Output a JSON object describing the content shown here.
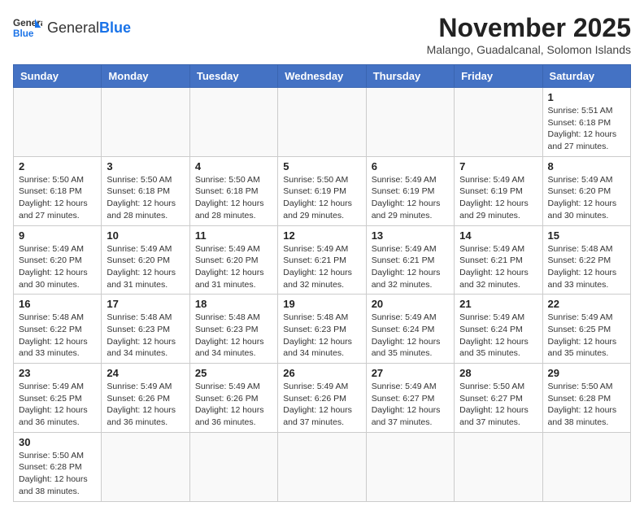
{
  "logo": {
    "general": "General",
    "blue": "Blue"
  },
  "title": "November 2025",
  "subtitle": "Malango, Guadalcanal, Solomon Islands",
  "headers": [
    "Sunday",
    "Monday",
    "Tuesday",
    "Wednesday",
    "Thursday",
    "Friday",
    "Saturday"
  ],
  "weeks": [
    [
      {
        "day": "",
        "info": ""
      },
      {
        "day": "",
        "info": ""
      },
      {
        "day": "",
        "info": ""
      },
      {
        "day": "",
        "info": ""
      },
      {
        "day": "",
        "info": ""
      },
      {
        "day": "",
        "info": ""
      },
      {
        "day": "1",
        "info": "Sunrise: 5:51 AM\nSunset: 6:18 PM\nDaylight: 12 hours and 27 minutes."
      }
    ],
    [
      {
        "day": "2",
        "info": "Sunrise: 5:50 AM\nSunset: 6:18 PM\nDaylight: 12 hours and 27 minutes."
      },
      {
        "day": "3",
        "info": "Sunrise: 5:50 AM\nSunset: 6:18 PM\nDaylight: 12 hours and 28 minutes."
      },
      {
        "day": "4",
        "info": "Sunrise: 5:50 AM\nSunset: 6:18 PM\nDaylight: 12 hours and 28 minutes."
      },
      {
        "day": "5",
        "info": "Sunrise: 5:50 AM\nSunset: 6:19 PM\nDaylight: 12 hours and 29 minutes."
      },
      {
        "day": "6",
        "info": "Sunrise: 5:49 AM\nSunset: 6:19 PM\nDaylight: 12 hours and 29 minutes."
      },
      {
        "day": "7",
        "info": "Sunrise: 5:49 AM\nSunset: 6:19 PM\nDaylight: 12 hours and 29 minutes."
      },
      {
        "day": "8",
        "info": "Sunrise: 5:49 AM\nSunset: 6:20 PM\nDaylight: 12 hours and 30 minutes."
      }
    ],
    [
      {
        "day": "9",
        "info": "Sunrise: 5:49 AM\nSunset: 6:20 PM\nDaylight: 12 hours and 30 minutes."
      },
      {
        "day": "10",
        "info": "Sunrise: 5:49 AM\nSunset: 6:20 PM\nDaylight: 12 hours and 31 minutes."
      },
      {
        "day": "11",
        "info": "Sunrise: 5:49 AM\nSunset: 6:20 PM\nDaylight: 12 hours and 31 minutes."
      },
      {
        "day": "12",
        "info": "Sunrise: 5:49 AM\nSunset: 6:21 PM\nDaylight: 12 hours and 32 minutes."
      },
      {
        "day": "13",
        "info": "Sunrise: 5:49 AM\nSunset: 6:21 PM\nDaylight: 12 hours and 32 minutes."
      },
      {
        "day": "14",
        "info": "Sunrise: 5:49 AM\nSunset: 6:21 PM\nDaylight: 12 hours and 32 minutes."
      },
      {
        "day": "15",
        "info": "Sunrise: 5:48 AM\nSunset: 6:22 PM\nDaylight: 12 hours and 33 minutes."
      }
    ],
    [
      {
        "day": "16",
        "info": "Sunrise: 5:48 AM\nSunset: 6:22 PM\nDaylight: 12 hours and 33 minutes."
      },
      {
        "day": "17",
        "info": "Sunrise: 5:48 AM\nSunset: 6:23 PM\nDaylight: 12 hours and 34 minutes."
      },
      {
        "day": "18",
        "info": "Sunrise: 5:48 AM\nSunset: 6:23 PM\nDaylight: 12 hours and 34 minutes."
      },
      {
        "day": "19",
        "info": "Sunrise: 5:48 AM\nSunset: 6:23 PM\nDaylight: 12 hours and 34 minutes."
      },
      {
        "day": "20",
        "info": "Sunrise: 5:49 AM\nSunset: 6:24 PM\nDaylight: 12 hours and 35 minutes."
      },
      {
        "day": "21",
        "info": "Sunrise: 5:49 AM\nSunset: 6:24 PM\nDaylight: 12 hours and 35 minutes."
      },
      {
        "day": "22",
        "info": "Sunrise: 5:49 AM\nSunset: 6:25 PM\nDaylight: 12 hours and 35 minutes."
      }
    ],
    [
      {
        "day": "23",
        "info": "Sunrise: 5:49 AM\nSunset: 6:25 PM\nDaylight: 12 hours and 36 minutes."
      },
      {
        "day": "24",
        "info": "Sunrise: 5:49 AM\nSunset: 6:26 PM\nDaylight: 12 hours and 36 minutes."
      },
      {
        "day": "25",
        "info": "Sunrise: 5:49 AM\nSunset: 6:26 PM\nDaylight: 12 hours and 36 minutes."
      },
      {
        "day": "26",
        "info": "Sunrise: 5:49 AM\nSunset: 6:26 PM\nDaylight: 12 hours and 37 minutes."
      },
      {
        "day": "27",
        "info": "Sunrise: 5:49 AM\nSunset: 6:27 PM\nDaylight: 12 hours and 37 minutes."
      },
      {
        "day": "28",
        "info": "Sunrise: 5:50 AM\nSunset: 6:27 PM\nDaylight: 12 hours and 37 minutes."
      },
      {
        "day": "29",
        "info": "Sunrise: 5:50 AM\nSunset: 6:28 PM\nDaylight: 12 hours and 38 minutes."
      }
    ],
    [
      {
        "day": "30",
        "info": "Sunrise: 5:50 AM\nSunset: 6:28 PM\nDaylight: 12 hours and 38 minutes."
      },
      {
        "day": "",
        "info": ""
      },
      {
        "day": "",
        "info": ""
      },
      {
        "day": "",
        "info": ""
      },
      {
        "day": "",
        "info": ""
      },
      {
        "day": "",
        "info": ""
      },
      {
        "day": "",
        "info": ""
      }
    ]
  ]
}
